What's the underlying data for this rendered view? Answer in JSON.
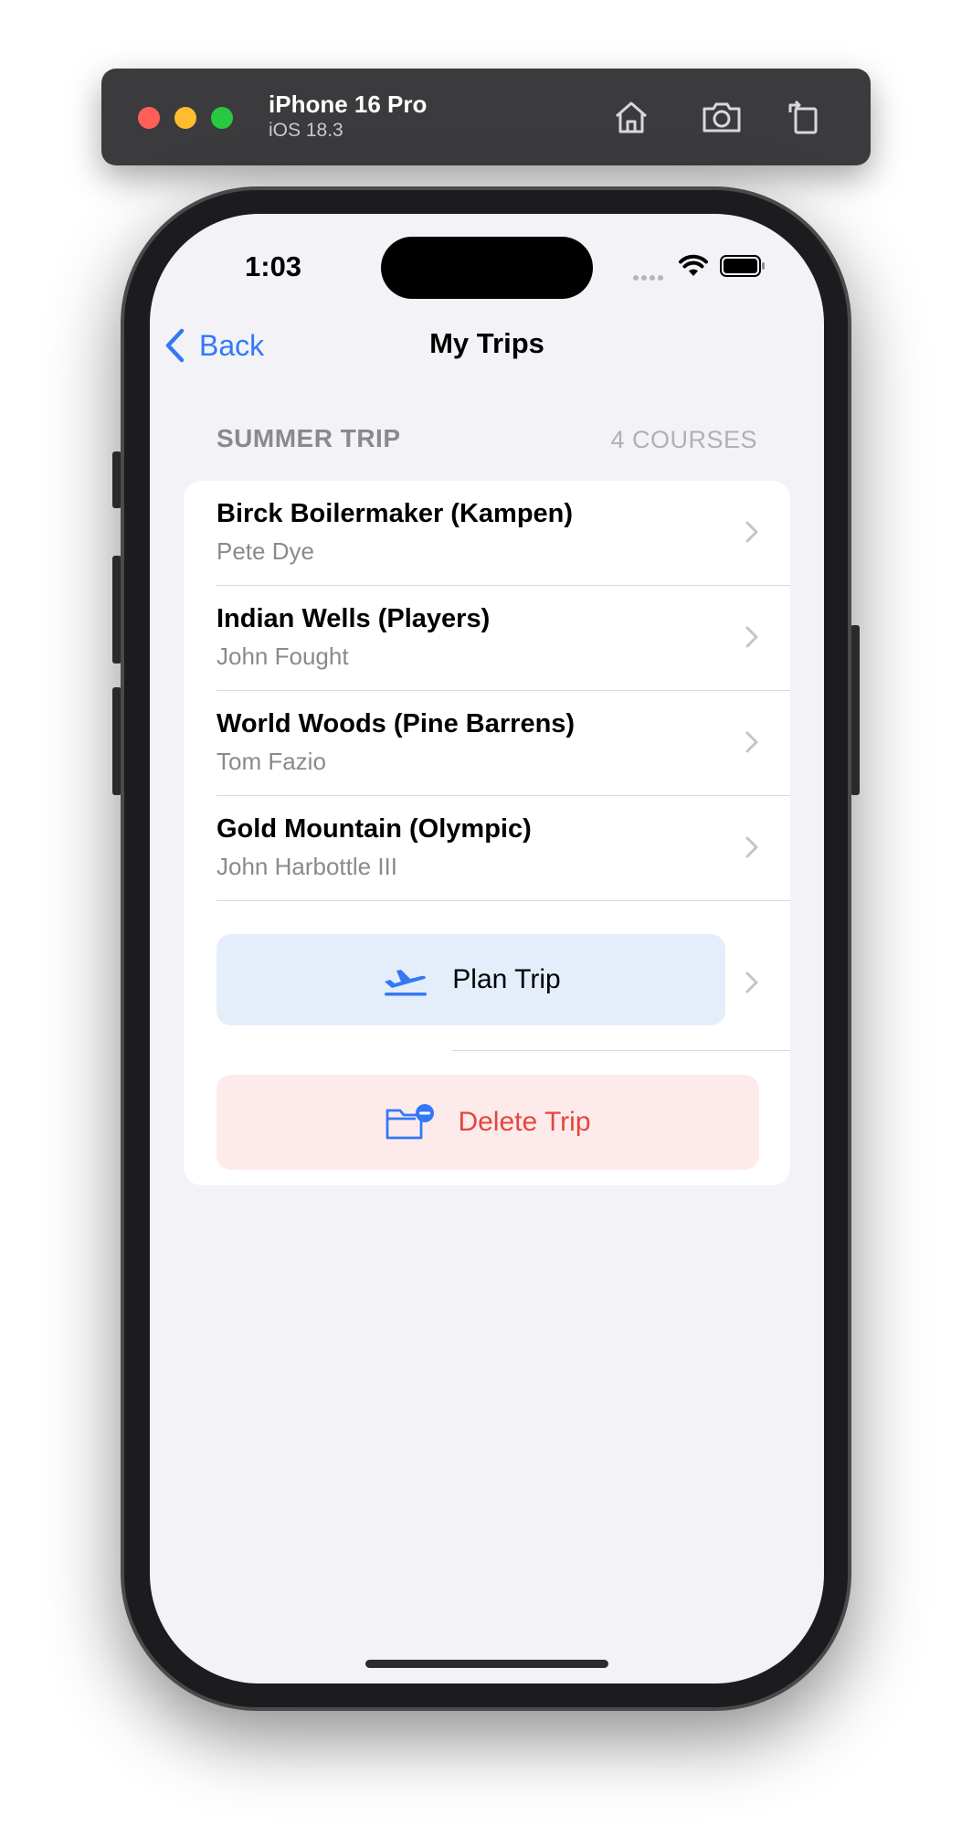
{
  "simulator": {
    "device_name": "iPhone 16 Pro",
    "os_version": "iOS 18.3",
    "home_icon": "home-icon",
    "screenshot_icon": "camera-icon",
    "rotate_icon": "rotate-icon"
  },
  "status_bar": {
    "time": "1:03"
  },
  "nav": {
    "back_label": "Back",
    "title": "My Trips"
  },
  "section": {
    "title": "SUMMER TRIP",
    "count": "4 COURSES"
  },
  "courses": [
    {
      "name": "Birck Boilermaker (Kampen)",
      "architect": "Pete Dye"
    },
    {
      "name": "Indian Wells (Players)",
      "architect": "John Fought"
    },
    {
      "name": "World Woods (Pine Barrens)",
      "architect": "Tom Fazio"
    },
    {
      "name": "Gold Mountain (Olympic)",
      "architect": "John Harbottle III"
    }
  ],
  "actions": {
    "plan_label": "Plan Trip",
    "delete_label": "Delete Trip"
  },
  "colors": {
    "accent": "#3478f6",
    "destructive": "#e5463e",
    "background": "#f2f2f7"
  }
}
